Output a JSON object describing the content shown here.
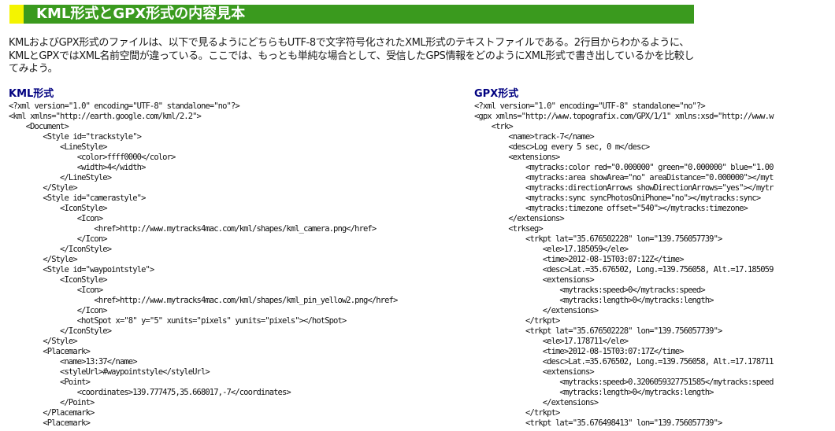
{
  "header": {
    "title": "KML形式とGPX形式の内容見本"
  },
  "intro": "KMLおよびGPX形式のファイルは、以下で見るようにどちらもUTF-8で文字符号化されたXML形式のテキストファイルである。2行目からわかるように、KMLとGPXではXML名前空間が違っている。ここでは、もっとも単純な場合として、受信したGPS情報をどのようにXML形式で書き出しているかを比較してみよう。",
  "kml": {
    "heading": "KML形式",
    "lines": [
      "<?xml version=\"1.0\" encoding=\"UTF-8\" standalone=\"no\"?>",
      "<kml xmlns=\"http://earth.google.com/kml/2.2\">",
      "    <Document>",
      "        <Style id=\"trackstyle\">",
      "            <LineStyle>",
      "                <color>ffff0000</color>",
      "                <width>4</width>",
      "            </LineStyle>",
      "        </Style>",
      "        <Style id=\"camerastyle\">",
      "            <IconStyle>",
      "                <Icon>",
      "                    <href>http://www.mytracks4mac.com/kml/shapes/kml_camera.png</href>",
      "                </Icon>",
      "            </IconStyle>",
      "        </Style>",
      "        <Style id=\"waypointstyle\">",
      "            <IconStyle>",
      "                <Icon>",
      "                    <href>http://www.mytracks4mac.com/kml/shapes/kml_pin_yellow2.png</href>",
      "                </Icon>",
      "                <hotSpot x=\"8\" y=\"5\" xunits=\"pixels\" yunits=\"pixels\"></hotSpot>",
      "            </IconStyle>",
      "        </Style>",
      "        <Placemark>",
      "            <name>13:37</name>",
      "            <styleUrl>#waypointstyle</styleUrl>",
      "            <Point>",
      "                <coordinates>139.777475,35.668017,-7</coordinates>",
      "            </Point>",
      "        </Placemark>",
      "        <Placemark>"
    ]
  },
  "gpx": {
    "heading": "GPX形式",
    "lines": [
      "<?xml version=\"1.0\" encoding=\"UTF-8\" standalone=\"no\"?>",
      "<gpx xmlns=\"http://www.topografix.com/GPX/1/1\" xmlns:xsd=\"http://www.w",
      "    <trk>",
      "        <name>track-7</name>",
      "        <desc>Log every 5 sec, 0 m</desc>",
      "        <extensions>",
      "            <mytracks:color red=\"0.000000\" green=\"0.000000\" blue=\"1.00",
      "            <mytracks:area showArea=\"no\" areaDistance=\"0.000000\"></myt",
      "            <mytracks:directionArrows showDirectionArrows=\"yes\"></mytr",
      "            <mytracks:sync syncPhotosOniPhone=\"no\"></mytracks:sync>",
      "            <mytracks:timezone offset=\"540\"></mytracks:timezone>",
      "        </extensions>",
      "        <trkseg>",
      "            <trkpt lat=\"35.676502228\" lon=\"139.756057739\">",
      "                <ele>17.185059</ele>",
      "                <time>2012-08-15T03:07:12Z</time>",
      "                <desc>Lat.=35.676502, Long.=139.756058, Alt.=17.185059",
      "                <extensions>",
      "                    <mytracks:speed>0</mytracks:speed>",
      "                    <mytracks:length>0</mytracks:length>",
      "                </extensions>",
      "            </trkpt>",
      "            <trkpt lat=\"35.676502228\" lon=\"139.756057739\">",
      "                <ele>17.178711</ele>",
      "                <time>2012-08-15T03:07:17Z</time>",
      "                <desc>Lat.=35.676502, Long.=139.756058, Alt.=17.178711",
      "                <extensions>",
      "                    <mytracks:speed>0.3206059327751585</mytracks:speed",
      "                    <mytracks:length>0</mytracks:length>",
      "                </extensions>",
      "            </trkpt>",
      "            <trkpt lat=\"35.676498413\" lon=\"139.756057739\">"
    ]
  }
}
